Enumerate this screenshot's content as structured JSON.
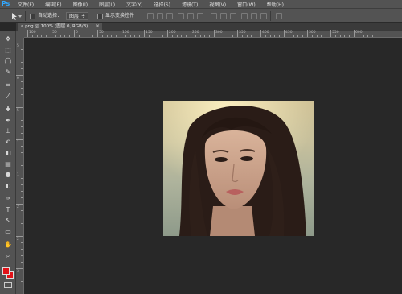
{
  "app": {
    "logo": "Ps"
  },
  "menu": [
    "文件(F)",
    "编辑(E)",
    "图像(I)",
    "图层(L)",
    "文字(Y)",
    "选择(S)",
    "滤镜(T)",
    "视图(V)",
    "窗口(W)",
    "帮助(H)"
  ],
  "options": {
    "auto_select_label": "自动选择：",
    "auto_select_value": "图层",
    "show_transform_label": "显示变换控件"
  },
  "document_tab": {
    "title": "a.png @ 100% (图层 0, RGB/8)",
    "close": "×"
  },
  "ruler_h": [
    {
      "label": "100"
    },
    {
      "label": "50"
    },
    {
      "label": "0"
    },
    {
      "label": "50"
    },
    {
      "label": "100"
    },
    {
      "label": "150"
    },
    {
      "label": "200"
    },
    {
      "label": "250"
    },
    {
      "label": "300"
    },
    {
      "label": "350"
    },
    {
      "label": "400"
    },
    {
      "label": "450"
    },
    {
      "label": "500"
    },
    {
      "label": "550"
    },
    {
      "label": "600"
    }
  ],
  "ruler_v": [
    {
      "label": "5"
    },
    {
      "label": "0"
    },
    {
      "label": "5"
    },
    {
      "label": "1"
    },
    {
      "label": "1"
    },
    {
      "label": "2"
    },
    {
      "label": "2"
    },
    {
      "label": "3"
    }
  ],
  "tools": [
    {
      "name": "move-tool-icon",
      "glyph": "✥"
    },
    {
      "name": "marquee-tool-icon",
      "glyph": "⬚"
    },
    {
      "name": "lasso-tool-icon",
      "glyph": "◯"
    },
    {
      "name": "quick-select-tool-icon",
      "glyph": "✎"
    },
    {
      "name": "crop-tool-icon",
      "glyph": "⌗"
    },
    {
      "name": "eyedropper-tool-icon",
      "glyph": "⁄"
    },
    {
      "name": "healing-brush-tool-icon",
      "glyph": "✚"
    },
    {
      "name": "brush-tool-icon",
      "glyph": "✒"
    },
    {
      "name": "clone-stamp-tool-icon",
      "glyph": "⊥"
    },
    {
      "name": "history-brush-tool-icon",
      "glyph": "↶"
    },
    {
      "name": "eraser-tool-icon",
      "glyph": "◧"
    },
    {
      "name": "gradient-tool-icon",
      "glyph": "▤"
    },
    {
      "name": "blur-tool-icon",
      "glyph": "●"
    },
    {
      "name": "dodge-tool-icon",
      "glyph": "◐"
    },
    {
      "name": "pen-tool-icon",
      "glyph": "✑"
    },
    {
      "name": "type-tool-icon",
      "glyph": "T"
    },
    {
      "name": "path-select-tool-icon",
      "glyph": "↖"
    },
    {
      "name": "shape-tool-icon",
      "glyph": "▭"
    },
    {
      "name": "hand-tool-icon",
      "glyph": "✋"
    },
    {
      "name": "zoom-tool-icon",
      "glyph": "⌕"
    }
  ],
  "colors": {
    "foreground": "#e11218",
    "background": "#e11218",
    "canvas_bg": "#282828",
    "panel_bg": "#535353"
  }
}
